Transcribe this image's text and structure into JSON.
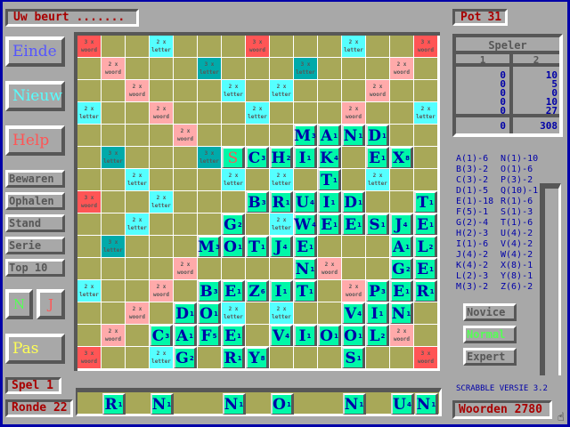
{
  "status": {
    "turn": "Uw beurt .......",
    "pot_label": "Pot",
    "pot": "31"
  },
  "buttons": {
    "einde": "Einde",
    "nieuw": "Nieuw",
    "help": "Help",
    "bewaren": "Bewaren",
    "ophalen": "Ophalen",
    "stand": "Stand",
    "serie": "Serie",
    "top10": "Top 10",
    "n": "N",
    "j": "J",
    "pas": "Pas"
  },
  "levels": {
    "novice": "Novice",
    "normal": "Normal",
    "expert": "Expert",
    "selected": "Normal"
  },
  "game": {
    "spel": "Spel 1",
    "ronde": "Ronde 22",
    "version": "SCRABBLE VERSIE 3.2",
    "woorden": "Woorden 2780"
  },
  "scoreboard": {
    "title": "Speler",
    "players": [
      "1",
      "2"
    ],
    "player1_scores": [
      "0",
      "0",
      "0",
      "0",
      "0"
    ],
    "player2_scores": [
      "10",
      "5",
      "0",
      "10",
      "27"
    ],
    "totals": [
      "0",
      "308"
    ]
  },
  "letter_pool": [
    "A(1)-6",
    "B(3)-2",
    "C(3)-2",
    "D(1)-5",
    "E(1)-18",
    "F(5)-1",
    "G(2)-4",
    "H(2)-3",
    "I(1)-6",
    "J(4)-2",
    "K(4)-2",
    "L(2)-3",
    "M(3)-2",
    "N(1)-10",
    "O(1)-6",
    "P(3)-2",
    "Q(10)-1",
    "R(1)-6",
    "S(1)-3",
    "T(1)-6",
    "U(4)-2",
    "V(4)-2",
    "W(4)-2",
    "X(8)-1",
    "Y(8)-1",
    "Z(6)-2"
  ],
  "letter_values": {
    "A": 1,
    "B": 3,
    "C": 3,
    "D": 1,
    "E": 1,
    "F": 5,
    "G": 2,
    "H": 2,
    "I": 1,
    "J": 4,
    "K": 4,
    "L": 2,
    "M": 3,
    "N": 1,
    "O": 1,
    "P": 3,
    "Q": 10,
    "R": 1,
    "S": 1,
    "T": 1,
    "U": 4,
    "V": 4,
    "W": 4,
    "X": 8,
    "Y": 8,
    "Z": 6
  },
  "premium_labels": {
    "T": [
      "3 x",
      "woord"
    ],
    "D": [
      "2 x",
      "woord"
    ],
    "t": [
      "3 x",
      "letter"
    ],
    "d": [
      "2 x",
      "letter"
    ]
  },
  "premium_colors": {
    "T": "#ff5555",
    "D": "#ffaaaa",
    "t": "#00aaaa",
    "d": "#55ffff",
    ".": "#a8a858"
  },
  "premium_map": [
    "T..d...T...d..T",
    ".D...t...t...D.",
    "..D...d.d...D..",
    "d..D...d...D..d",
    "....D.....D....",
    ".t...t...t...t.",
    "..d...d.d...d..",
    "T..d...D...d..T",
    "..d...d.d...d..",
    ".t...t...t...t.",
    "....D.....D....",
    "d..D...d...D..d",
    "..D...d.d...D..",
    ".D...t...t...D.",
    "T..d...T...d..T"
  ],
  "board": [
    "...............",
    "...............",
    "...............",
    "...............",
    ".........MAND..",
    "......sCHIK.EX.",
    "..........T....",
    ".......BRUID..T",
    "......G..WEESJE",
    ".....MOTJE...AL",
    ".........N...GE",
    ".....BEZIT..PER",
    "....DO.....VIN.",
    "...CAFE.VIOOL..",
    "....G.RY...S..."
  ],
  "rack": ".R.N..N.O..N.UN"
}
